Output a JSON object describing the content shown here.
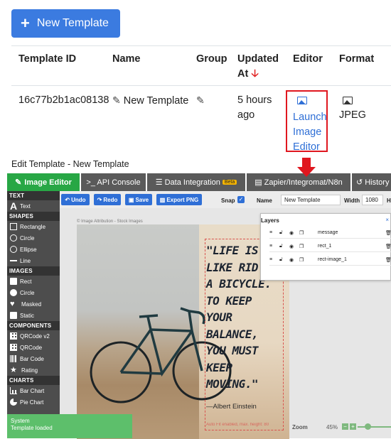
{
  "top": {
    "new_button": "New Template",
    "table": {
      "headers": [
        "Template ID",
        "Name",
        "Group",
        "Updated",
        "At",
        "Editor",
        "Format"
      ],
      "row": {
        "id": "16c77b2b1ac08138",
        "name": "New Template",
        "updated_line1": "5 hours",
        "updated_line2": "ago",
        "editor_lines": [
          "Launch",
          "Image",
          "Editor"
        ],
        "format": "JPEG"
      }
    }
  },
  "editor": {
    "title": "Edit Template - New Template",
    "tabs": [
      "Image Editor",
      ">_ API Console",
      "Data Integration",
      "Zapier/Integromat/N8n",
      "History"
    ],
    "beta_badge": "Beta",
    "sidebar": {
      "sections": [
        "TEXT",
        "SHAPES",
        "IMAGES",
        "COMPONENTS",
        "CHARTS"
      ],
      "text_items": [
        "Text"
      ],
      "shape_items": [
        "Rectangle",
        "Circle",
        "Ellipse",
        "Line"
      ],
      "image_items": [
        "Rect",
        "Circle",
        "Masked",
        "Static"
      ],
      "component_items": [
        "QRCode v2",
        "QRCode",
        "Bar Code",
        "Rating"
      ],
      "chart_items": [
        "Bar Chart",
        "Pie Chart"
      ]
    },
    "toolbar": {
      "undo": "Undo",
      "redo": "Redo",
      "save": "Save",
      "export": "Export PNG",
      "snap": "Snap",
      "name_label": "Name",
      "name_value": "New Template",
      "width_label": "Width",
      "width_value": "1080",
      "height_label": "H"
    },
    "canvas": {
      "attribution": "© Image Attribution - Stock Images",
      "quote_lines": [
        "\"LIFE IS",
        "LIKE RID",
        "A BICYCLE.",
        "TO KEEP",
        "YOUR",
        "BALANCE,",
        "YOU MUST",
        "KEEP",
        "MOVING.\""
      ],
      "author": "—Albert Einstein",
      "bottom_note": "Auto Fit enabled, max. height: 80"
    },
    "layers": {
      "title": "Layers",
      "close": "×",
      "items": [
        "message",
        "rect_1",
        "rect-image_1"
      ]
    },
    "zoom": {
      "label": "Zoom",
      "value": "45%"
    },
    "toast": {
      "line1": "System",
      "line2": "Template loaded"
    }
  },
  "colors": {
    "primary": "#3b7be0",
    "success": "#28a745",
    "highlight": "#e0171f"
  }
}
